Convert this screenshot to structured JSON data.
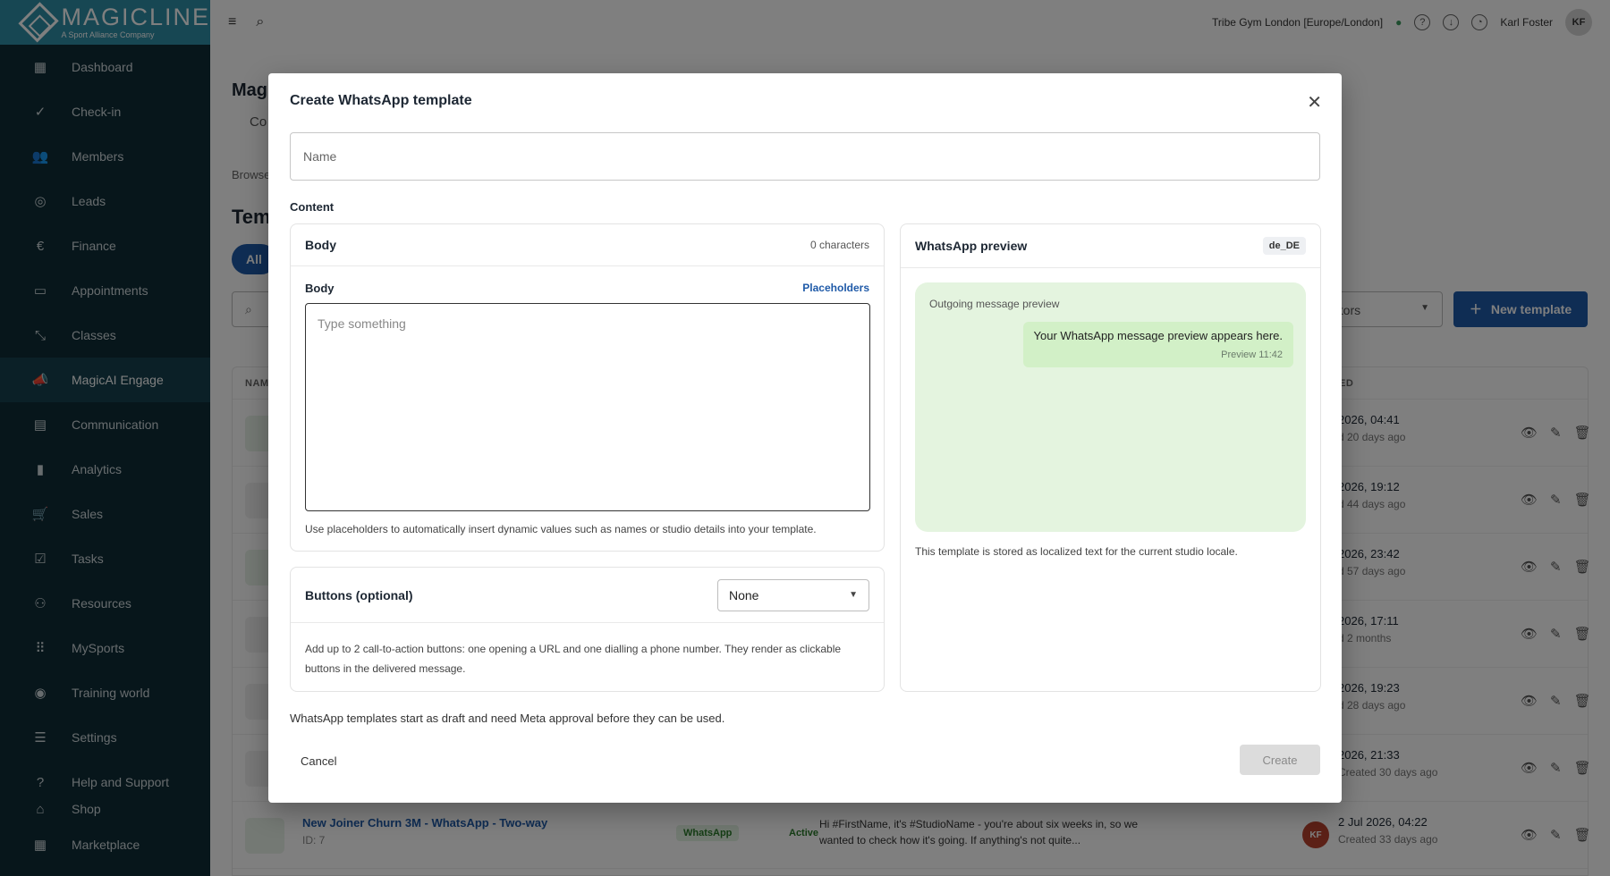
{
  "sidebar": {
    "brand": "MAGICLINE",
    "brand_sub": "A Sport Alliance Company",
    "items": [
      {
        "label": "Dashboard",
        "icon": "dashboard-icon"
      },
      {
        "label": "Check-in",
        "icon": "check-in-icon"
      },
      {
        "label": "Members",
        "icon": "members-icon"
      },
      {
        "label": "Leads",
        "icon": "leads-icon"
      },
      {
        "label": "Finance",
        "icon": "euro-icon"
      },
      {
        "label": "Appointments",
        "icon": "calendar-icon"
      },
      {
        "label": "Classes",
        "icon": "classes-icon"
      },
      {
        "label": "MagicAI Engage",
        "icon": "megaphone-icon"
      },
      {
        "label": "Communication",
        "icon": "chat-icon"
      },
      {
        "label": "Analytics",
        "icon": "bar-chart-icon"
      },
      {
        "label": "Sales",
        "icon": "cart-icon"
      },
      {
        "label": "Tasks",
        "icon": "checkbox-icon"
      },
      {
        "label": "Resources",
        "icon": "resources-icon"
      },
      {
        "label": "MySports",
        "icon": "grid-icon"
      },
      {
        "label": "Training world",
        "icon": "training-icon"
      },
      {
        "label": "Settings",
        "icon": "sliders-icon"
      },
      {
        "label": "Help and Support",
        "icon": "help-icon"
      },
      {
        "label": "Shop",
        "icon": "shop-icon"
      },
      {
        "label": "Marketplace",
        "icon": "marketplace-icon"
      }
    ]
  },
  "topbar": {
    "studio": "Tribe Gym London [Europe/London]",
    "user": "Karl Foster",
    "initials": "KF"
  },
  "main": {
    "page_title": "MagicAI Engage",
    "tab_partial": "Co",
    "crumb_partial": "Browse",
    "section_partial": "Temp",
    "filter_chip": "All",
    "filter_partial": "ators",
    "new_template": "New template",
    "table": {
      "col_name": "NAM",
      "col_created": "ED",
      "rows": [
        {
          "date": "2026, 04:41",
          "ago": "d 20 days ago"
        },
        {
          "date": "2026, 19:12",
          "ago": "d 44 days ago"
        },
        {
          "date": "2026, 23:42",
          "ago": "d 57 days ago"
        },
        {
          "date": "2026, 17:11",
          "ago": "d 2 months"
        },
        {
          "date": "2026, 19:23",
          "ago": "d 28 days ago"
        },
        {
          "date": "2026, 21:33",
          "ago": "Created 30 days ago"
        }
      ],
      "last_row": {
        "name": "New Joiner Churn 3M - WhatsApp - Two-way",
        "id": "ID: 7",
        "channel": "WhatsApp",
        "status": "Active",
        "message": "Hi #FirstName, it's #StudioName - you're about six weeks in, so we wanted to check how it's going. If anything's not quite...",
        "initials": "KF",
        "date": "2 Jul 2026, 04:22",
        "ago": "Created 33 days ago"
      }
    }
  },
  "modal": {
    "title": "Create WhatsApp template",
    "name_placeholder": "Name",
    "content_label": "Content",
    "body": {
      "title": "Body",
      "char_count": "0 characters",
      "field_label": "Body",
      "placeholders_link": "Placeholders",
      "placeholder": "Type something",
      "help": "Use placeholders to automatically insert dynamic values such as names or studio details into your template."
    },
    "buttons": {
      "title": "Buttons (optional)",
      "selected": "None",
      "desc": "Add up to 2 call-to-action buttons: one opening a URL and one dialling a phone number. They render as clickable buttons in the delivered message."
    },
    "preview": {
      "title": "WhatsApp preview",
      "locale": "de_DE",
      "outgoing_label": "Outgoing message preview",
      "bubble_text": "Your WhatsApp message preview appears here.",
      "bubble_meta": "Preview  11:42",
      "note": "This template is stored as localized text for the current studio locale."
    },
    "footnote": "WhatsApp templates start as draft and need Meta approval before they can be used.",
    "cancel": "Cancel",
    "create": "Create"
  }
}
